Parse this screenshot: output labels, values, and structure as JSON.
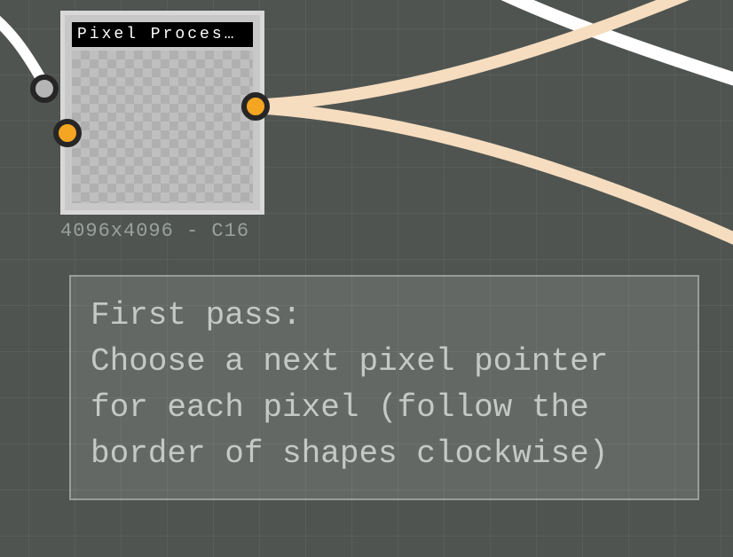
{
  "node": {
    "title": "Pixel Proces…",
    "meta": "4096x4096 - C16",
    "ports": {
      "input_top": {
        "name": "input-port-1",
        "color": "gray",
        "interactable": true
      },
      "input_bottom": {
        "name": "input-port-2",
        "color": "orange",
        "interactable": true
      },
      "output": {
        "name": "output-port",
        "color": "orange",
        "interactable": true
      }
    }
  },
  "annotation": {
    "lines": [
      "First pass:",
      "Choose a next pixel pointer",
      "for each pixel (follow the",
      "border of shapes clockwise)"
    ]
  },
  "edges": {
    "in_white": {
      "stroke": "#ffffff",
      "width": 12
    },
    "out_top_white": {
      "stroke": "#ffffff",
      "width": 15
    },
    "out_cream": {
      "stroke": "#f6ddc0",
      "width": 14
    }
  }
}
